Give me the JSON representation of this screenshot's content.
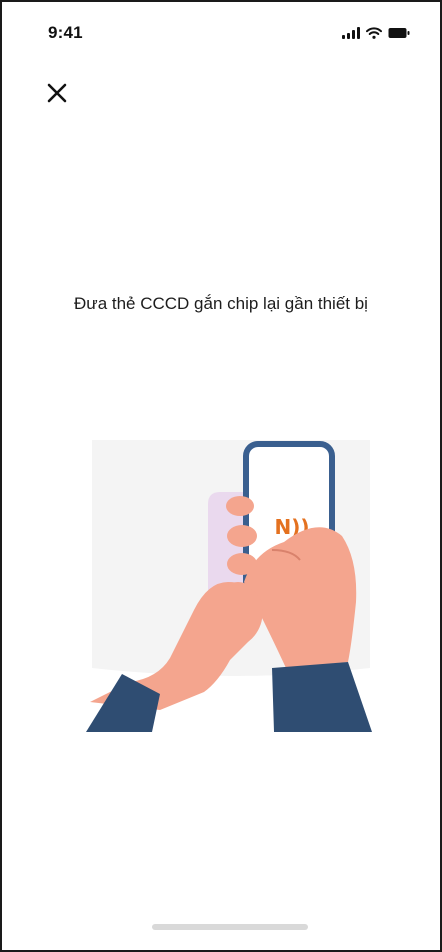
{
  "status_bar": {
    "time": "9:41",
    "icons": [
      "signal-icon",
      "wifi-icon",
      "battery-icon"
    ]
  },
  "header": {
    "close_icon": "close-icon"
  },
  "main": {
    "instruction": "Đưa thẻ CCCD gắn chip lại gần thiết bị",
    "illustration": "hands-holding-phone-with-nfc-card-illustration",
    "nfc_glyph": "N))"
  },
  "colors": {
    "phone_frame": "#3a5f8f",
    "skin": "#f4a58e",
    "sleeve": "#2f4d72",
    "card": "#ead9ee",
    "nfc": "#e4711f",
    "background_blob": "#f4f4f4"
  }
}
